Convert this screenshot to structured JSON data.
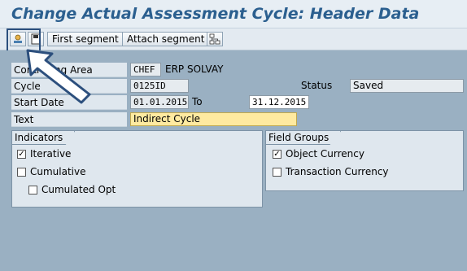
{
  "header": {
    "title": "Change Actual Assessment Cycle: Header Data"
  },
  "toolbar": {
    "icons": [
      "display-icon",
      "save-segment-icon",
      "hierarchy-icon"
    ],
    "first_segment": "First segment",
    "attach_segment": "Attach segment"
  },
  "form": {
    "controlling_area_label": "Controlling Area",
    "controlling_area_value": "CHEF",
    "controlling_area_desc": "ERP SOLVAY",
    "cycle_label": "Cycle",
    "cycle_value": "0125ID",
    "status_label": "Status",
    "status_value": "Saved",
    "start_date_label": "Start Date",
    "start_date_value": "01.01.2015",
    "to_label": "To",
    "end_date_value": "31.12.2015",
    "text_label": "Text",
    "text_value": "Indirect Cycle"
  },
  "indicators": {
    "title": "Indicators",
    "iterative": {
      "label": "Iterative",
      "checked": true
    },
    "cumulative": {
      "label": "Cumulative",
      "checked": false
    },
    "cumulated_opt": {
      "label": "Cumulated Opt",
      "checked": false
    }
  },
  "field_groups": {
    "title": "Field Groups",
    "object_currency": {
      "label": "Object Currency",
      "checked": true
    },
    "transaction_currency": {
      "label": "Transaction Currency",
      "checked": false
    }
  },
  "colors": {
    "title": "#2b5f8f",
    "background": "#9ab0c2",
    "highlight": "#ffeaa0",
    "arrow": "#2c4f7d"
  }
}
